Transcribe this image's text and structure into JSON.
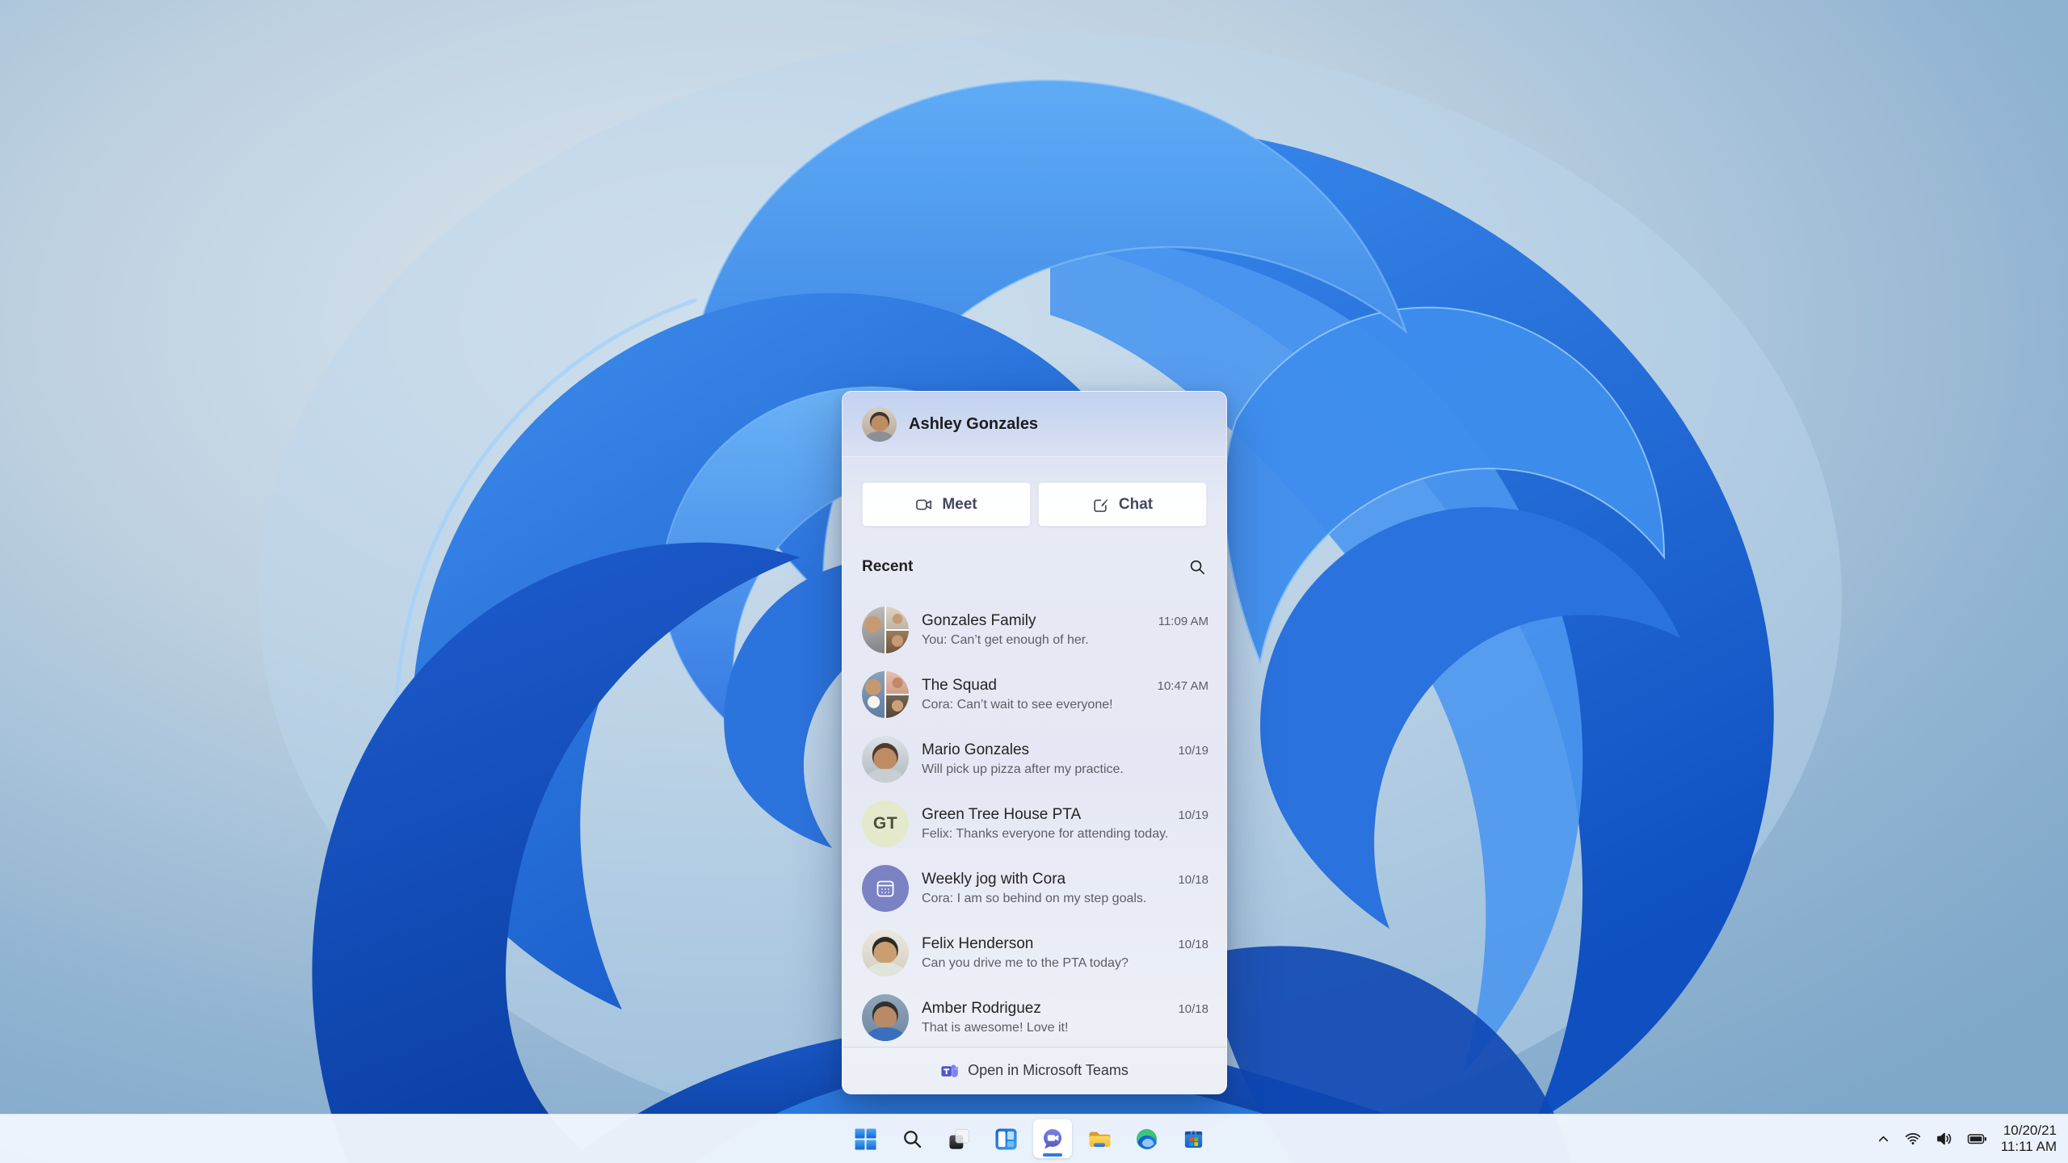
{
  "desktop": {
    "wallpaper_name": "windows-11-bloom"
  },
  "chat_flyout": {
    "user": {
      "name": "Ashley Gonzales"
    },
    "buttons": {
      "meet": "Meet",
      "chat": "Chat"
    },
    "recent_title": "Recent",
    "conversations": [
      {
        "name": "Gonzales Family",
        "preview": "You: Can’t get enough of her.",
        "time": "11:09 AM",
        "avatar": "photo-collage"
      },
      {
        "name": "The Squad",
        "preview": "Cora: Can’t wait to see everyone!",
        "time": "10:47 AM",
        "avatar": "photo-collage"
      },
      {
        "name": "Mario Gonzales",
        "preview": "Will pick up pizza after my practice.",
        "time": "10/19",
        "avatar": "photo"
      },
      {
        "name": "Green Tree House PTA",
        "preview": "Felix: Thanks everyone for attending today.",
        "time": "10/19",
        "avatar": "initials",
        "initials": "GT"
      },
      {
        "name": "Weekly jog with Cora",
        "preview": "Cora: I am so behind on my step goals.",
        "time": "10/18",
        "avatar": "calendar-icon"
      },
      {
        "name": "Felix Henderson",
        "preview": "Can you drive me to the PTA today?",
        "time": "10/18",
        "avatar": "photo"
      },
      {
        "name": "Amber Rodriguez",
        "preview": "That is awesome! Love it!",
        "time": "10/18",
        "avatar": "photo"
      }
    ],
    "footer": {
      "label": "Open in Microsoft Teams"
    }
  },
  "taskbar": {
    "items": [
      "start",
      "search",
      "task-view",
      "widgets",
      "chat",
      "file-explorer",
      "edge",
      "store"
    ],
    "active_item": "chat",
    "tray": {
      "date": "10/20/21",
      "time": "11:11 AM"
    }
  },
  "colors": {
    "accent_blue": "#2f7cd9",
    "teams_purple": "#5f65c4",
    "gt_avatar_bg": "#e5e9cc",
    "gt_avatar_fg": "#4a5139",
    "calendar_avatar_bg": "#7b82c3"
  }
}
